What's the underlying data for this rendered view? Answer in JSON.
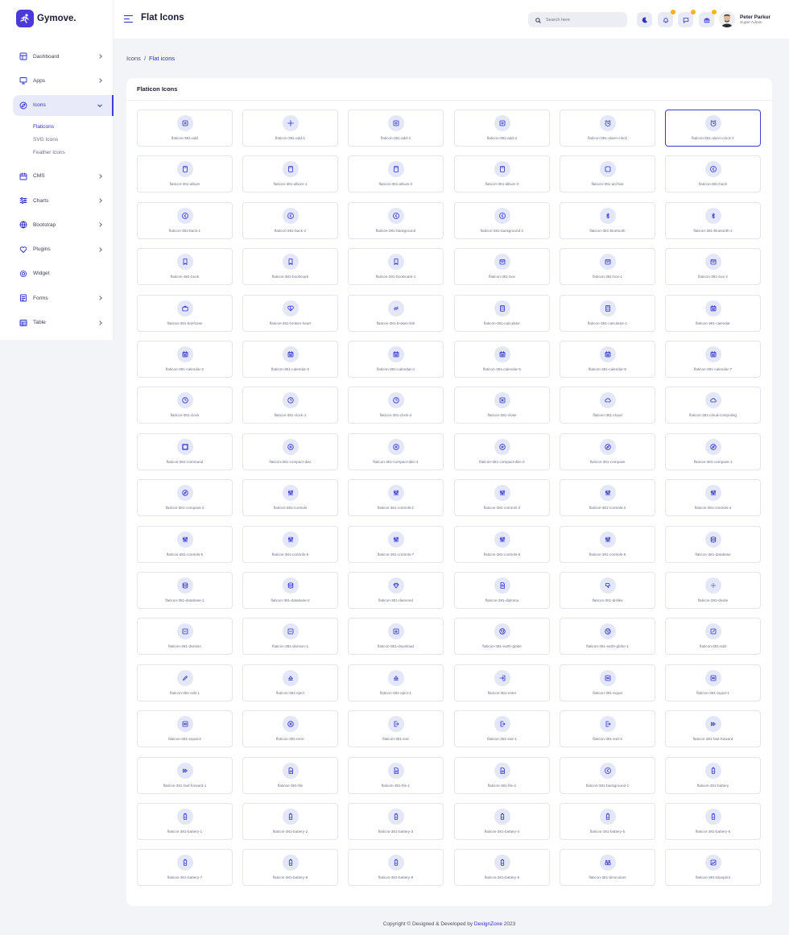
{
  "app": {
    "name": "Gymove.",
    "logo_icon": "runner-icon"
  },
  "colors": {
    "primary": "#3b3fd6",
    "accent_dot": "#f8b21e",
    "icon_bg": "#e4e7f7"
  },
  "sidebar": {
    "items": [
      {
        "label": "Dashboard",
        "icon": "dashboard-icon",
        "has_arrow": true
      },
      {
        "label": "Apps",
        "icon": "monitor-icon",
        "has_arrow": true
      },
      {
        "label": "Icons",
        "icon": "compass-icon",
        "has_arrow": true,
        "active": true,
        "sub": [
          {
            "label": "Flaticons",
            "current": true
          },
          {
            "label": "SVG Icons"
          },
          {
            "label": "Feather Icons"
          }
        ]
      },
      {
        "label": "CMS",
        "icon": "cms-icon",
        "has_arrow": true
      },
      {
        "label": "Charts",
        "icon": "sliders-icon",
        "has_arrow": true
      },
      {
        "label": "Bootstrap",
        "icon": "globe-icon",
        "has_arrow": true
      },
      {
        "label": "Plugins",
        "icon": "heart-icon",
        "has_arrow": true
      },
      {
        "label": "Widget",
        "icon": "settings-icon",
        "has_arrow": false
      },
      {
        "label": "Forms",
        "icon": "forms-icon",
        "has_arrow": true
      },
      {
        "label": "Table",
        "icon": "table-icon",
        "has_arrow": true
      }
    ]
  },
  "header": {
    "title": "Flat Icons",
    "search_placeholder": "Search here",
    "notification_icons": [
      "moon-icon",
      "bell-icon",
      "chat-icon",
      "gift-icon"
    ],
    "user": {
      "name": "Peter Parkur",
      "role": "Super Admin"
    }
  },
  "breadcrumb": {
    "root": "Icons",
    "separator": "/",
    "current": "Flat icons"
  },
  "card": {
    "title": "Flaticon Icons"
  },
  "icons": [
    "flaticon-381-add",
    "flaticon-381-add-1",
    "flaticon-381-add-2",
    "flaticon-381-add-3",
    "flaticon-381-alarm-clock",
    "flaticon-381-alarm-clock-1",
    "flaticon-381-album",
    "flaticon-381-album-1",
    "flaticon-381-album-2",
    "flaticon-381-album-3",
    "flaticon-381-archive",
    "flaticon-381-back",
    "flaticon-381-back-1",
    "flaticon-381-back-2",
    "flaticon-381-background",
    "flaticon-381-background-1",
    "flaticon-381-bluetooth",
    "flaticon-381-bluetooth-1",
    "flaticon-381-book",
    "flaticon-381-bookmark",
    "flaticon-381-bookmark-1",
    "flaticon-381-box",
    "flaticon-381-box-1",
    "flaticon-381-box-2",
    "flaticon-381-briefcase",
    "flaticon-381-broken-heart",
    "flaticon-381-broken-link",
    "flaticon-381-calculator",
    "flaticon-381-calculator-1",
    "flaticon-381-calendar",
    "flaticon-381-calendar-2",
    "flaticon-381-calendar-3",
    "flaticon-381-calendar-4",
    "flaticon-381-calendar-5",
    "flaticon-381-calendar-6",
    "flaticon-381-calendar-7",
    "flaticon-381-clock",
    "flaticon-381-clock-1",
    "flaticon-381-clock-2",
    "flaticon-381-close",
    "flaticon-381-cloud",
    "flaticon-381-cloud-computing",
    "flaticon-381-command",
    "flaticon-381-compact-disc",
    "flaticon-381-compact-disc-1",
    "flaticon-381-compact-disc-2",
    "flaticon-381-compass",
    "flaticon-381-compass-1",
    "flaticon-381-compass-2",
    "flaticon-381-controls",
    "flaticon-381-controls-1",
    "flaticon-381-controls-2",
    "flaticon-381-controls-3",
    "flaticon-381-controls-4",
    "flaticon-381-controls-5",
    "flaticon-381-controls-6",
    "flaticon-381-controls-7",
    "flaticon-381-controls-8",
    "flaticon-381-controls-9",
    "flaticon-381-database",
    "flaticon-381-database-1",
    "flaticon-381-database-2",
    "flaticon-381-diamond",
    "flaticon-381-diploma",
    "flaticon-381-dislike",
    "flaticon-381-divide",
    "flaticon-381-division",
    "flaticon-381-division-1",
    "flaticon-381-download",
    "flaticon-381-earth-globe",
    "flaticon-381-earth-globe-1",
    "flaticon-381-edit",
    "flaticon-381-edit-1",
    "flaticon-381-eject",
    "flaticon-381-eject-1",
    "flaticon-381-enter",
    "flaticon-381-equal",
    "flaticon-381-equal-1",
    "flaticon-381-equal-2",
    "flaticon-381-error",
    "flaticon-381-exit",
    "flaticon-381-exit-1",
    "flaticon-381-exit-2",
    "flaticon-381-fast-forward",
    "flaticon-381-fast-forward-1",
    "flaticon-381-file",
    "flaticon-381-file-1",
    "flaticon-381-file-2",
    "flaticon-381-background-1",
    "flaticon-381-battery",
    "flaticon-381-battery-1",
    "flaticon-381-battery-2",
    "flaticon-381-battery-3",
    "flaticon-381-battery-4",
    "flaticon-381-battery-5",
    "flaticon-381-battery-6",
    "flaticon-381-battery-7",
    "flaticon-381-battery-8",
    "flaticon-381-battery-9",
    "flaticon-381-battery-9",
    "flaticon-381-binoculars",
    "flaticon-381-blueprint"
  ],
  "footer": {
    "text": "Copyright © Designed & Developed by ",
    "brand": "DexignZone",
    "year": " 2023"
  }
}
